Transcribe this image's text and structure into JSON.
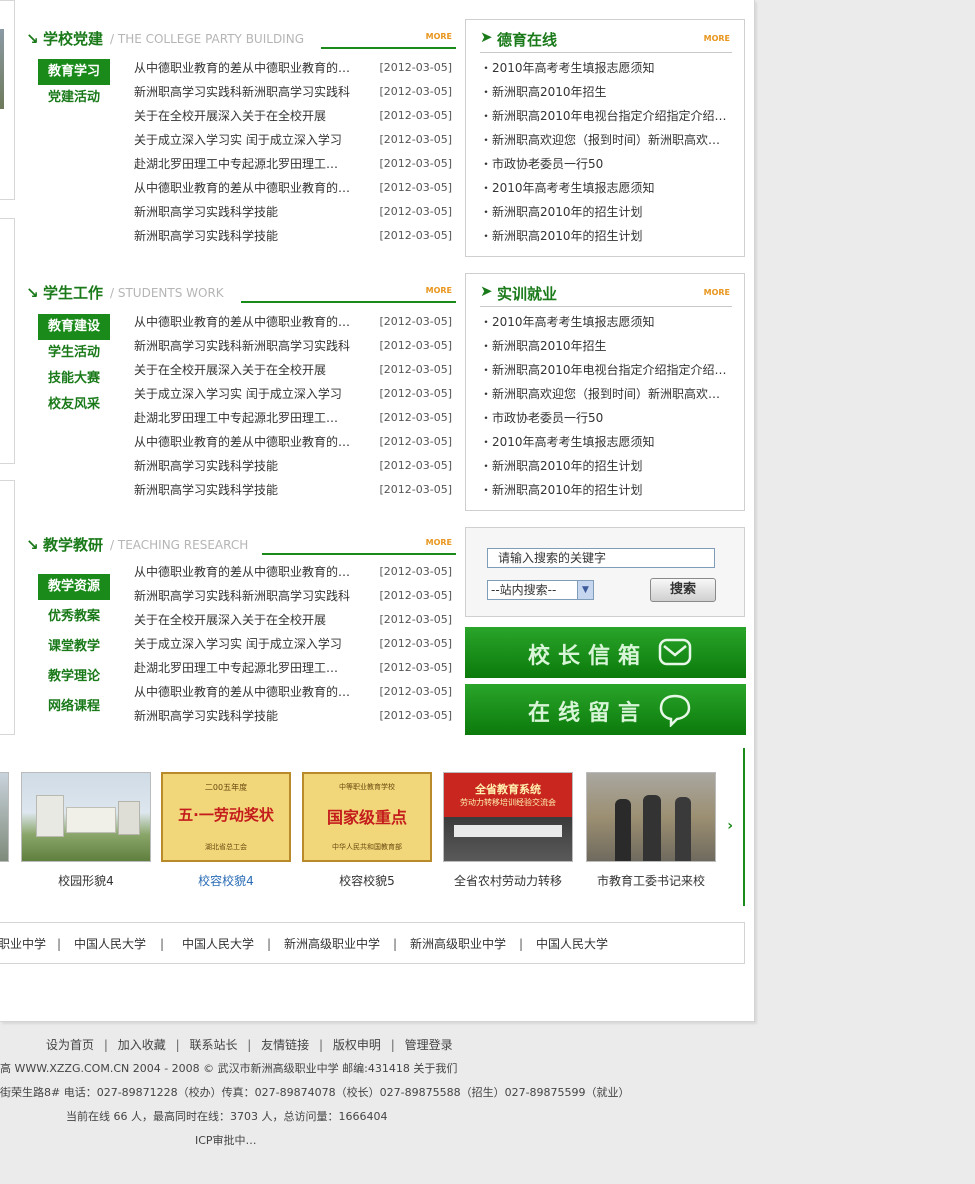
{
  "sections": [
    {
      "title": "学校党建",
      "en": "/ THE COLLEGE PARTY BUILDING",
      "more": "MORE",
      "subnav": [
        "教育学习",
        "党建活动"
      ],
      "news": [
        {
          "title": "从中德职业教育的差从中德职业教育的…",
          "date": "[2012-03-05]"
        },
        {
          "title": "新洲职高学习实践科新洲职高学习实践科",
          "date": "[2012-03-05]"
        },
        {
          "title": "关于在全校开展深入关于在全校开展",
          "date": "[2012-03-05]"
        },
        {
          "title": "关于成立深入学习实 闰于成立深入学习",
          "date": "[2012-03-05]"
        },
        {
          "title": "赴湖北罗田理工中专起源北罗田理工…",
          "date": "[2012-03-05]"
        },
        {
          "title": "从中德职业教育的差从中德职业教育的…",
          "date": "[2012-03-05]"
        },
        {
          "title": "新洲职高学习实践科学技能",
          "date": "[2012-03-05]"
        },
        {
          "title": "新洲职高学习实践科学技能",
          "date": "[2012-03-05]"
        }
      ]
    },
    {
      "title": "学生工作",
      "en": "/ STUDENTS WORK",
      "more": "MORE",
      "subnav": [
        "教育建设",
        "学生活动",
        "技能大赛",
        "校友风采"
      ],
      "news": [
        {
          "title": "从中德职业教育的差从中德职业教育的…",
          "date": "[2012-03-05]"
        },
        {
          "title": "新洲职高学习实践科新洲职高学习实践科",
          "date": "[2012-03-05]"
        },
        {
          "title": "关于在全校开展深入关于在全校开展",
          "date": "[2012-03-05]"
        },
        {
          "title": "关于成立深入学习实 闰于成立深入学习",
          "date": "[2012-03-05]"
        },
        {
          "title": "赴湖北罗田理工中专起源北罗田理工…",
          "date": "[2012-03-05]"
        },
        {
          "title": "从中德职业教育的差从中德职业教育的…",
          "date": "[2012-03-05]"
        },
        {
          "title": "新洲职高学习实践科学技能",
          "date": "[2012-03-05]"
        },
        {
          "title": "新洲职高学习实践科学技能",
          "date": "[2012-03-05]"
        }
      ]
    },
    {
      "title": "教学教研",
      "en": "/ TEACHING RESEARCH",
      "more": "MORE",
      "subnav": [
        "教学资源",
        "优秀教案",
        "课堂教学",
        "教学理论",
        "网络课程"
      ],
      "news": [
        {
          "title": "从中德职业教育的差从中德职业教育的…",
          "date": "[2012-03-05]"
        },
        {
          "title": "新洲职高学习实践科新洲职高学习实践科",
          "date": "[2012-03-05]"
        },
        {
          "title": "关于在全校开展深入关于在全校开展",
          "date": "[2012-03-05]"
        },
        {
          "title": "关于成立深入学习实 闰于成立深入学习",
          "date": "[2012-03-05]"
        },
        {
          "title": "赴湖北罗田理工中专起源北罗田理工…",
          "date": "[2012-03-05]"
        },
        {
          "title": "从中德职业教育的差从中德职业教育的…",
          "date": "[2012-03-05]"
        },
        {
          "title": "新洲职高学习实践科学技能",
          "date": "[2012-03-05]"
        }
      ]
    }
  ],
  "right_boxes": [
    {
      "title": "德育在线",
      "more": "MORE",
      "items": [
        "・2010年高考考生填报志愿须知",
        "・新洲职高2010年招生",
        "・新洲职高2010年电视台指定介绍指定介绍…",
        "・新洲职高欢迎您（报到时间）新洲职高欢…",
        "・市政协老委员一行50",
        "・2010年高考考生填报志愿须知",
        "・新洲职高2010年的招生计划",
        "・新洲职高2010年的招生计划"
      ]
    },
    {
      "title": "实训就业",
      "more": "MORE",
      "items": [
        "・2010年高考考生填报志愿须知",
        "・新洲职高2010年招生",
        "・新洲职高2010年电视台指定介绍指定介绍…",
        "・新洲职高欢迎您（报到时间）新洲职高欢…",
        "・市政协老委员一行50",
        "・2010年高考考生填报志愿须知",
        "・新洲职高2010年的招生计划",
        "・新洲职高2010年的招生计划"
      ]
    }
  ],
  "search": {
    "placeholder": "请输入搜索的关键字",
    "scope": "--站内搜索--",
    "button": "搜索"
  },
  "green_buttons": {
    "mailbox": "校长信箱",
    "message": "在线留言"
  },
  "gallery": {
    "items": [
      {
        "caption": "校园形貌4",
        "highlight": false
      },
      {
        "caption": "校容校貌4",
        "highlight": true
      },
      {
        "caption": "校容校貌5",
        "highlight": false
      },
      {
        "caption": "全省农村劳动力转移",
        "highlight": false
      },
      {
        "caption": "市教育工委书记来校",
        "highlight": false
      }
    ],
    "cert1_top": "二00五年度",
    "cert1_main": "五·一劳动奖状",
    "cert1_bottom": "湖北省总工会",
    "cert2_top": "中等职业教育学校",
    "cert2_main": "国家级重点",
    "cert2_bottom": "中华人民共和国教育部",
    "banner_text1": "全省教育系统",
    "banner_text2": "劳动力转移培训经验交流会",
    "next": "›"
  },
  "links": [
    "职业中学",
    "中国人民大学",
    "中国人民大学",
    "新洲高级职业中学",
    "新洲高级职业中学",
    "中国人民大学"
  ],
  "footer": {
    "nav": [
      "设为首页",
      "加入收藏",
      "联系站长",
      "友情链接",
      "版权申明",
      "管理登录"
    ],
    "line2": "高 WWW.XZZG.COM.CN   2004 - 2008 ©   武汉市新洲高级职业中学   邮编:431418   关于我们",
    "line3": "街荣生路8# 电话：027-89871228（校办）传真：027-89874078（校长）027-89875588（招生）027-89875599（就业）",
    "line4": "当前在线 66 人，最高同时在线：3703 人，总访问量：1666404",
    "line5": "ICP审批中…"
  }
}
